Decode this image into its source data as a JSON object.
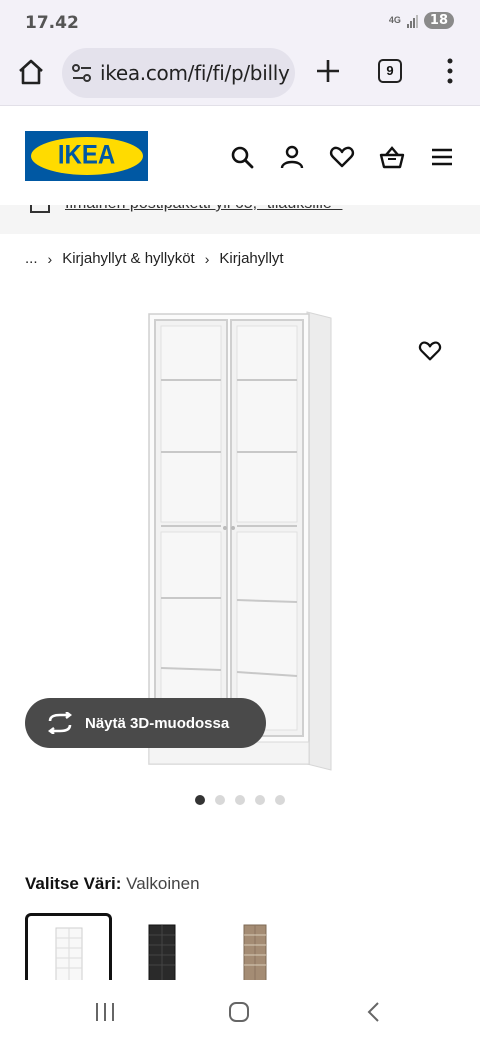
{
  "status": {
    "time": "17.42",
    "network": "4G",
    "battery": "18"
  },
  "browser": {
    "url": "ikea.com/fi/fi/p/billy",
    "tab_count": "9"
  },
  "promo": {
    "text": "Ilmainen postipaketti yli 65,- tilauksille *"
  },
  "breadcrumb": {
    "ellipsis": "...",
    "level1": "Kirjahyllyt & hyllyköt",
    "level2": "Kirjahyllyt"
  },
  "product": {
    "view3d_label": "Näytä 3D-muodossa",
    "image_count": 5,
    "active_image": 1
  },
  "color": {
    "label": "Valitse Väri:",
    "value": "Valkoinen",
    "swatches": [
      "white",
      "black",
      "oak"
    ]
  },
  "logo": {
    "text": "IKEA"
  },
  "colors": {
    "ikea_blue": "#0058a3",
    "ikea_yellow": "#ffdb00",
    "button_dark": "#4a4a4a"
  }
}
